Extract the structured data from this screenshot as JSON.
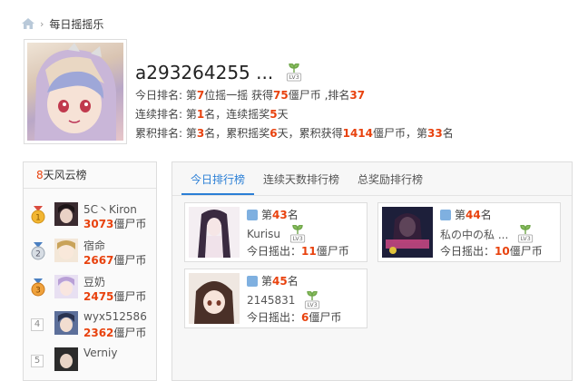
{
  "breadcrumb": {
    "current": "每日摇摇乐"
  },
  "profile": {
    "username": "a293264255 ...",
    "level": "LV3",
    "today": {
      "label": "今日排名: 第",
      "rank": "7",
      "mid": "位摇一摇 获得",
      "coins": "75",
      "unit": "僵尸币 ,排名",
      "rank2": "37"
    },
    "streak": {
      "label": "连续排名: 第",
      "rank": "1",
      "mid": "名，连续摇奖",
      "days": "5",
      "unit": "天"
    },
    "total": {
      "label": "累积排名: 第",
      "rank": "3",
      "mid": "名，累积摇奖",
      "days": "6",
      "mid2": "天，累积获得",
      "coins": "1414",
      "mid3": "僵尸币，第",
      "rank2": "33",
      "unit": "名"
    }
  },
  "leaderboard": {
    "title_num": "8",
    "title_text": "天风云榜",
    "items": [
      {
        "rank": "1",
        "name": "5C丶Kiron",
        "coins": "3073",
        "unit": "僵尸币"
      },
      {
        "rank": "2",
        "name": "宿命",
        "coins": "2667",
        "unit": "僵尸币"
      },
      {
        "rank": "3",
        "name": "豆奶",
        "coins": "2475",
        "unit": "僵尸币"
      },
      {
        "rank": "4",
        "name": "wyx512586",
        "coins": "2362",
        "unit": "僵尸币"
      },
      {
        "rank": "5",
        "name": "Verniy",
        "coins": "",
        "unit": ""
      }
    ]
  },
  "tabs": [
    "今日排行榜",
    "连续天数排行榜",
    "总奖励排行榜"
  ],
  "cards": [
    {
      "pre": "第",
      "rank": "43",
      "post": "名",
      "name": "Kurisu",
      "level": "LV3",
      "today_label": "今日摇出：",
      "amount": "11",
      "unit": "僵尸币"
    },
    {
      "pre": "第",
      "rank": "44",
      "post": "名",
      "name": "私の中の私 ...",
      "level": "LV3",
      "today_label": "今日摇出：",
      "amount": "10",
      "unit": "僵尸币"
    },
    {
      "pre": "第",
      "rank": "45",
      "post": "名",
      "name": "2145831",
      "level": "LV3",
      "today_label": "今日摇出：",
      "amount": "6",
      "unit": "僵尸币"
    }
  ],
  "colors": {
    "accent": "#2b7fd6",
    "highlight": "#e8420e"
  }
}
